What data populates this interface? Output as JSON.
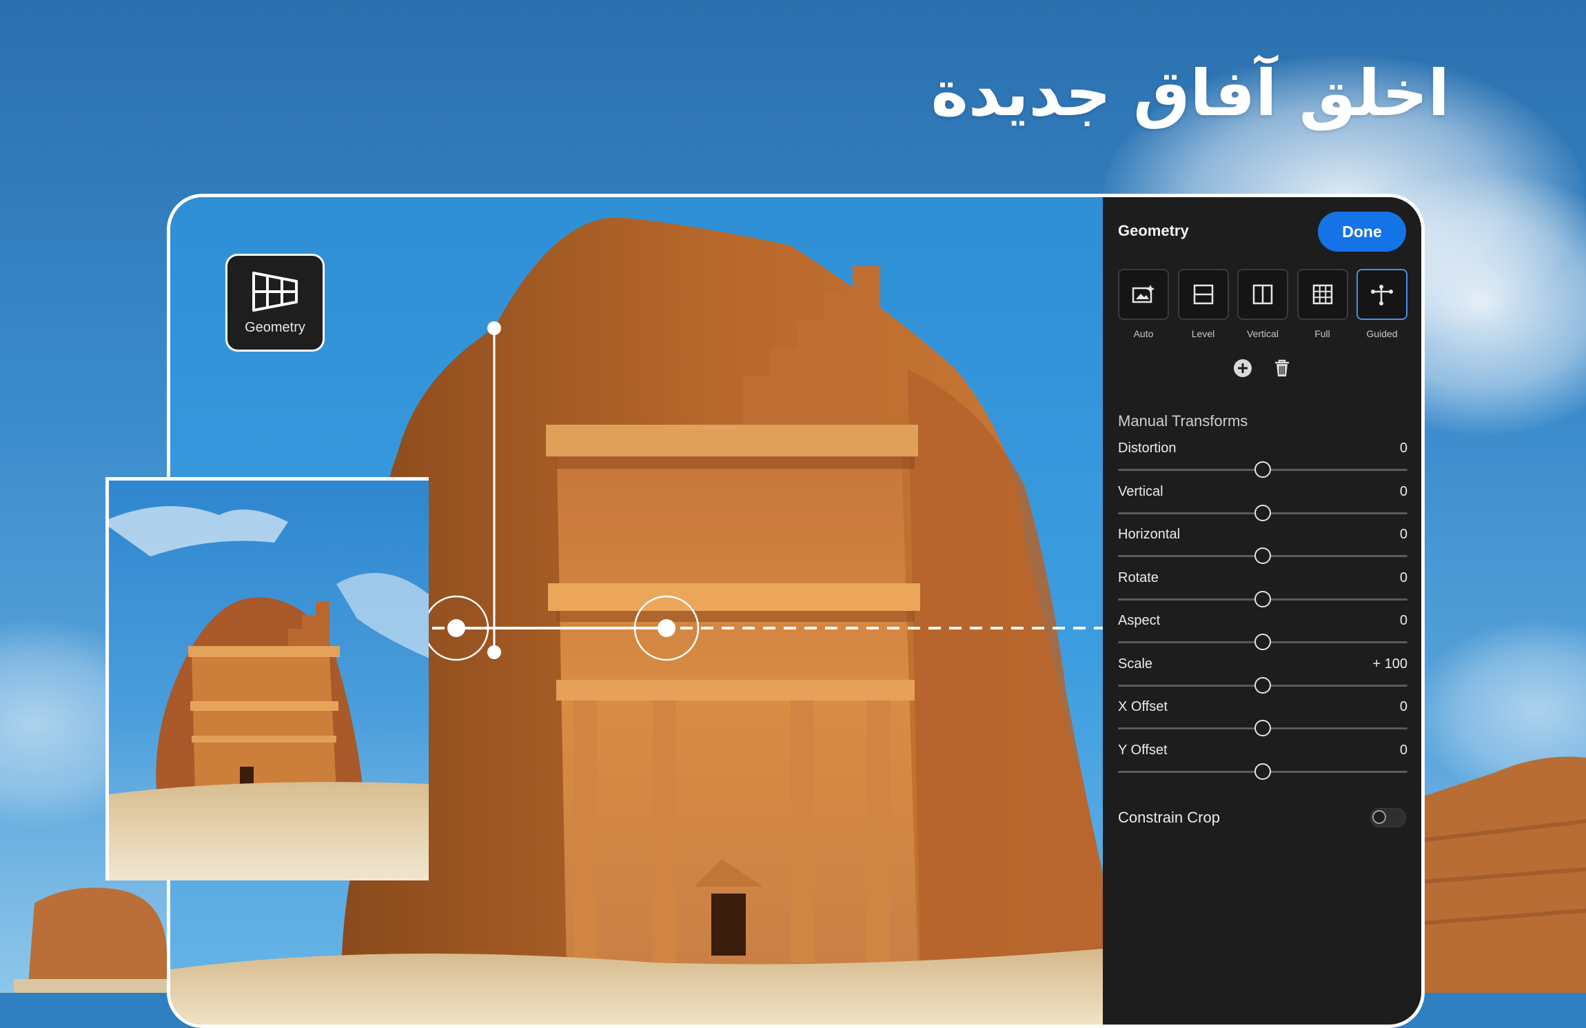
{
  "headline": "اخلق آفاق جديدة",
  "badge": {
    "label": "Geometry",
    "icon": "geometry-icon"
  },
  "panel": {
    "title": "Geometry",
    "done_label": "Done",
    "modes": [
      {
        "label": "Auto",
        "icon": "auto-upright-icon",
        "active": false
      },
      {
        "label": "Level",
        "icon": "level-icon",
        "active": false
      },
      {
        "label": "Vertical",
        "icon": "vertical-icon",
        "active": false
      },
      {
        "label": "Full",
        "icon": "full-grid-icon",
        "active": false
      },
      {
        "label": "Guided",
        "icon": "guided-icon",
        "active": true
      }
    ],
    "actions": {
      "add_icon": "add-guide-icon",
      "delete_icon": "trash-icon"
    },
    "section_title": "Manual Transforms",
    "sliders": [
      {
        "name": "Distortion",
        "value": "0",
        "position": 0.5
      },
      {
        "name": "Vertical",
        "value": "0",
        "position": 0.5
      },
      {
        "name": "Horizontal",
        "value": "0",
        "position": 0.5
      },
      {
        "name": "Rotate",
        "value": "0",
        "position": 0.5
      },
      {
        "name": "Aspect",
        "value": "0",
        "position": 0.5
      },
      {
        "name": "Scale",
        "value": "+ 100",
        "position": 0.5
      },
      {
        "name": "X Offset",
        "value": "0",
        "position": 0.5
      },
      {
        "name": "Y Offset",
        "value": "0",
        "position": 0.5
      }
    ],
    "constrain_crop": {
      "label": "Constrain Crop",
      "on": false
    }
  },
  "colors": {
    "accent": "#1473e6",
    "panel_bg": "#1d1d1d",
    "sky": "#3a8acb",
    "rock": "#c8772f"
  }
}
